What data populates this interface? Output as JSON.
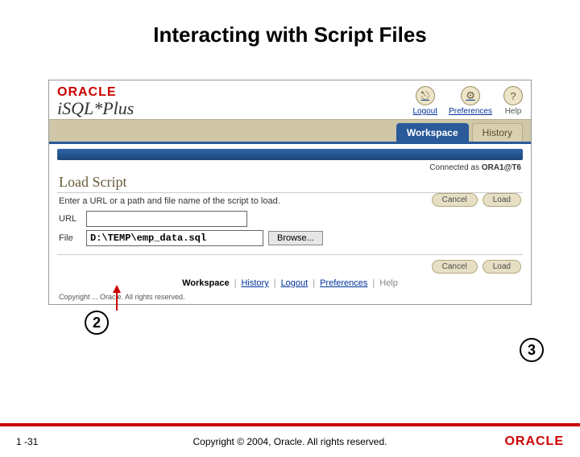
{
  "slide": {
    "title": "Interacting with Script Files",
    "page": "1 -31",
    "copyright": "Copyright © 2004, Oracle. All rights reserved."
  },
  "app": {
    "brand_logo_text": "ORACLE",
    "product": "iSQL*Plus",
    "topnav": {
      "logout": "Logout",
      "preferences": "Preferences",
      "help": "Help"
    },
    "tabs": {
      "workspace": "Workspace",
      "history": "History"
    },
    "connected_prefix": "Connected as ",
    "connected_user": "ORA1@T6",
    "section_title": "Load Script",
    "hint": "Enter a URL or a path and file name of the script to load.",
    "labels": {
      "url": "URL",
      "file": "File"
    },
    "inputs": {
      "url_value": "",
      "file_value": "D:\\TEMP\\emp_data.sql",
      "browse": "Browse..."
    },
    "buttons": {
      "cancel": "Cancel",
      "load": "Load"
    },
    "footer_nav": {
      "workspace": "Workspace",
      "history": "History",
      "logout": "Logout",
      "preferences": "Preferences",
      "help": "Help"
    },
    "inner_copyright": "Copyright ... Oracle. All rights reserved."
  },
  "callouts": {
    "two": "2",
    "three": "3"
  },
  "footer_logo": "ORACLE"
}
